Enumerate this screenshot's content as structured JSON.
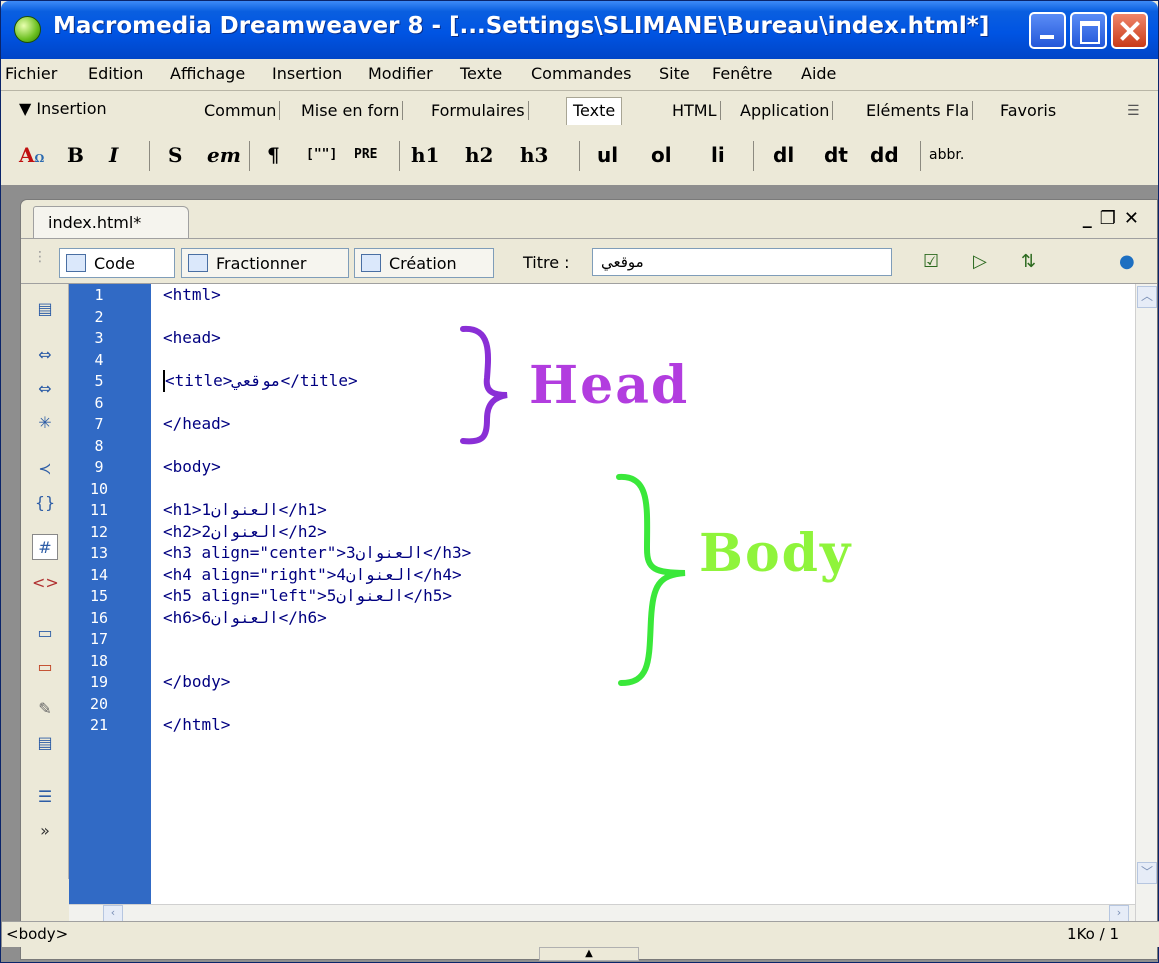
{
  "window": {
    "title": "Macromedia Dreamweaver 8 - [...Settings\\SLIMANE\\Bureau\\index.html*]"
  },
  "menu": [
    "Fichier",
    "Edition",
    "Affichage",
    "Insertion",
    "Modifier",
    "Texte",
    "Commandes",
    "Site",
    "Fenêtre",
    "Aide"
  ],
  "insert_bar": {
    "label": "▼ Insertion",
    "tabs": [
      "Commun",
      "Mise en forn",
      "Formulaires",
      "Texte",
      "HTML",
      "Application",
      "Eléments Fla",
      "Favoris"
    ],
    "active_tab": "Texte",
    "tools": {
      "font_tag": "A",
      "bold": "B",
      "italic": "I",
      "strong": "S",
      "em": "em",
      "paragraph": "¶",
      "blockquote": "[\"\"]",
      "pre": "PRE",
      "h1": "h1",
      "h2": "h2",
      "h3": "h3",
      "ul": "ul",
      "ol": "ol",
      "li": "li",
      "dl": "dl",
      "dt": "dt",
      "dd": "dd",
      "abbr": "abbr."
    }
  },
  "document": {
    "tab_label": "index.html*",
    "view_buttons": {
      "code": "Code",
      "split": "Fractionner",
      "design": "Création"
    },
    "title_label": "Titre :",
    "title_value": "موقعي"
  },
  "code": {
    "line_numbers": [
      "1",
      "2",
      "3",
      "4",
      "5",
      "6",
      "7",
      "8",
      "9",
      "10",
      "11",
      "12",
      "13",
      "14",
      "15",
      "16",
      "17",
      "18",
      "19",
      "20",
      "21"
    ],
    "lines": [
      "<html>",
      "",
      "<head>",
      "",
      "<title>موقعي</title>",
      "",
      "</head>",
      "",
      "<body>",
      "",
      "<h1>1العنوان</h1>",
      "<h2>2العنوان</h2>",
      "<h3 align=\"center\">3العنوان</h3>",
      "<h4 align=\"right\">4العنوان</h4>",
      "<h5 align=\"left\">5العنوان</h5>",
      "<h6>6العنوان</h6>",
      "",
      "</body>",
      "",
      "</html>",
      ""
    ]
  },
  "annotations": {
    "head": {
      "label": "Head",
      "color": "#b23ddf"
    },
    "body": {
      "label": "Body",
      "color": "#8ff43b"
    }
  },
  "status": {
    "tag_selector": "<body>",
    "size_info": "1Ko / 1"
  }
}
